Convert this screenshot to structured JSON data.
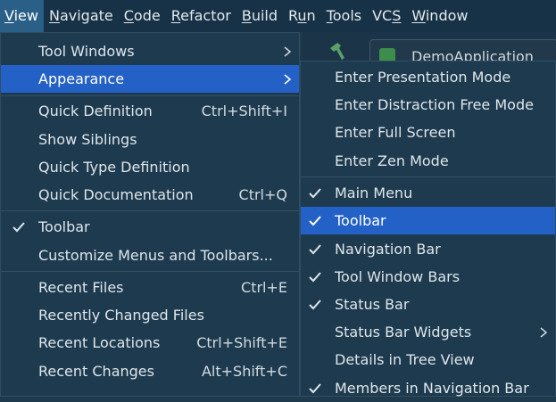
{
  "menubar": {
    "items": [
      "View",
      "Navigate",
      "Code",
      "Refactor",
      "Build",
      "Run",
      "Tools",
      "VCS",
      "Window"
    ],
    "mnemonics": [
      "V",
      "N",
      "C",
      "R",
      "B",
      "u",
      "T",
      "S",
      "W"
    ]
  },
  "background": {
    "run_config": "DemoApplication"
  },
  "view_menu": {
    "tool_windows": "Tool Windows",
    "appearance": "Appearance",
    "quick_definition": "Quick Definition",
    "quick_definition_shortcut": "Ctrl+Shift+I",
    "show_siblings": "Show Siblings",
    "quick_type_definition": "Quick Type Definition",
    "quick_documentation": "Quick Documentation",
    "quick_documentation_shortcut": "Ctrl+Q",
    "toolbar": "Toolbar",
    "customize": "Customize Menus and Toolbars...",
    "recent_files": "Recent Files",
    "recent_files_shortcut": "Ctrl+E",
    "recently_changed_files": "Recently Changed Files",
    "recent_locations": "Recent Locations",
    "recent_locations_shortcut": "Ctrl+Shift+E",
    "recent_changes": "Recent Changes",
    "recent_changes_shortcut": "Alt+Shift+C"
  },
  "appearance_menu": {
    "presentation_mode": "Enter Presentation Mode",
    "distraction_free_mode": "Enter Distraction Free Mode",
    "full_screen": "Enter Full Screen",
    "zen_mode": "Enter Zen Mode",
    "main_menu": "Main Menu",
    "toolbar": "Toolbar",
    "navigation_bar": "Navigation Bar",
    "tool_window_bars": "Tool Window Bars",
    "status_bar": "Status Bar",
    "status_bar_widgets": "Status Bar Widgets",
    "details_in_tree_view": "Details in Tree View",
    "members_in_navigation_bar": "Members in Navigation Bar"
  },
  "colors": {
    "menu_background": "#1d3a4f",
    "selection": "#2461c7",
    "menubar_active": "#2a5f87"
  }
}
